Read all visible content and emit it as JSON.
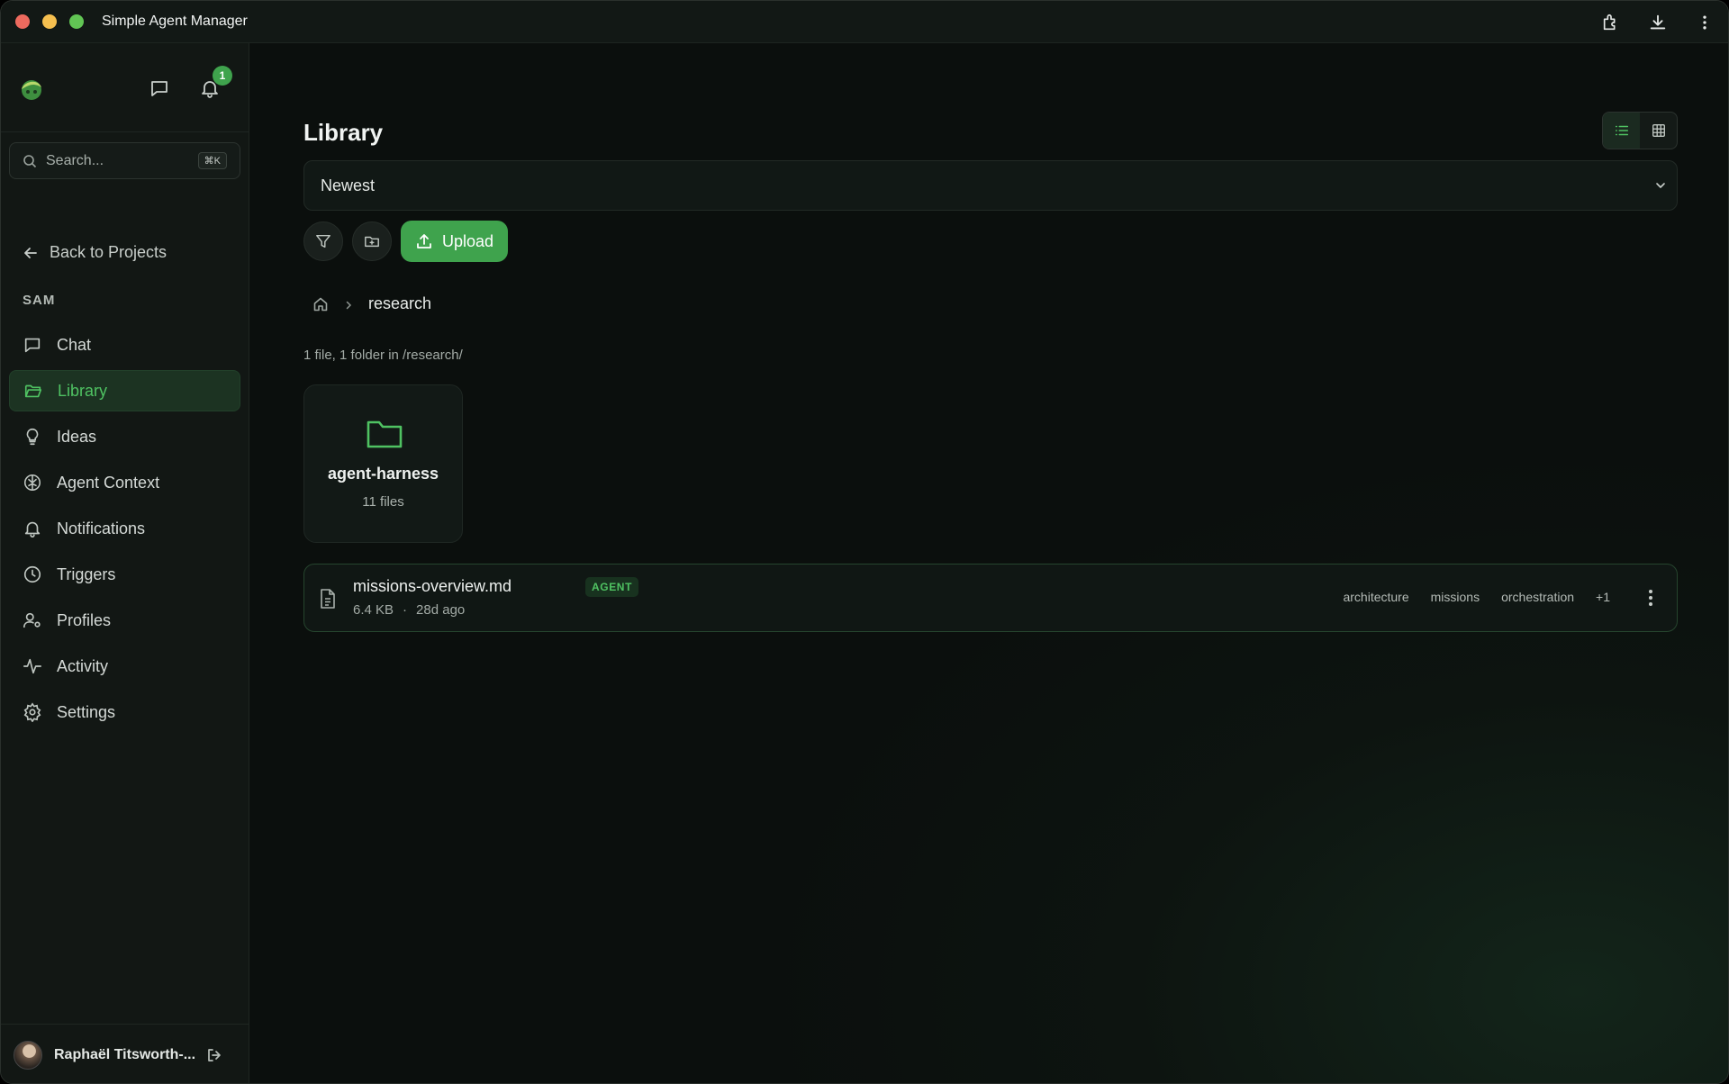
{
  "window": {
    "title": "Simple Agent Manager"
  },
  "sidebar": {
    "notification_count": "1",
    "search": {
      "placeholder": "Search...",
      "shortcut": "⌘K"
    },
    "back_label": "Back to Projects",
    "section": "SAM",
    "items": [
      {
        "label": "Chat",
        "icon": "chat-icon"
      },
      {
        "label": "Library",
        "icon": "folder-open-icon",
        "active": true
      },
      {
        "label": "Ideas",
        "icon": "lightbulb-icon"
      },
      {
        "label": "Agent Context",
        "icon": "brain-icon"
      },
      {
        "label": "Notifications",
        "icon": "bell-icon"
      },
      {
        "label": "Triggers",
        "icon": "clock-icon"
      },
      {
        "label": "Profiles",
        "icon": "user-gear-icon"
      },
      {
        "label": "Activity",
        "icon": "activity-icon"
      },
      {
        "label": "Settings",
        "icon": "gear-icon"
      }
    ],
    "user_name": "Raphaël Titsworth-..."
  },
  "main": {
    "title": "Library",
    "sort": {
      "value": "Newest"
    },
    "upload_label": "Upload",
    "breadcrumb": {
      "current": "research"
    },
    "count_text": "1 file, 1 folder in /research/",
    "folder": {
      "name": "agent-harness",
      "count": "11 files"
    },
    "file": {
      "name": "missions-overview.md",
      "badge": "AGENT",
      "size": "6.4 KB",
      "dot": "·",
      "age": "28d ago",
      "tags": [
        "architecture",
        "missions",
        "orchestration",
        "+1"
      ]
    }
  },
  "colors": {
    "accent": "#3fa34d",
    "accent_text": "#4fc262",
    "background": "#0b0f0d"
  }
}
